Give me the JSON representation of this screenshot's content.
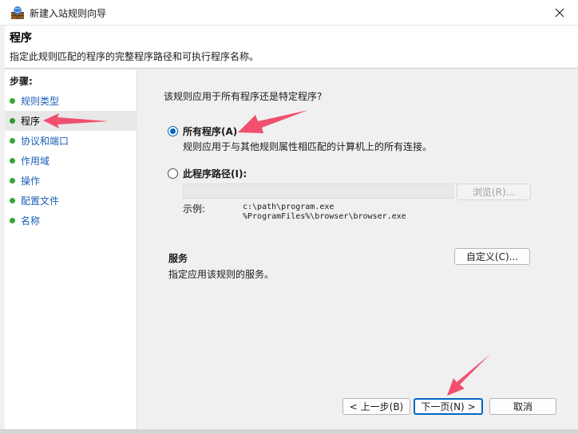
{
  "window": {
    "title": "新建入站规则向导"
  },
  "header": {
    "title": "程序",
    "description": "指定此规则匹配的程序的完整程序路径和可执行程序名称。"
  },
  "steps": {
    "heading": "步骤:",
    "items": [
      {
        "label": "规则类型"
      },
      {
        "label": "程序"
      },
      {
        "label": "协议和端口"
      },
      {
        "label": "作用域"
      },
      {
        "label": "操作"
      },
      {
        "label": "配置文件"
      },
      {
        "label": "名称"
      }
    ]
  },
  "content": {
    "question": "该规则应用于所有程序还是特定程序?",
    "all_programs": {
      "label": "所有程序(A)",
      "description": "规则应用于与其他规则属性相匹配的计算机上的所有连接。",
      "checked": true
    },
    "program_path": {
      "label": "此程序路径(I):",
      "value": "",
      "checked": false
    },
    "browse_button": "浏览(R)...",
    "example_label": "示例:",
    "example_line1": "c:\\path\\program.exe",
    "example_line2": "%ProgramFiles%\\browser\\browser.exe",
    "services_title": "服务",
    "services_description": "指定应用该规则的服务。",
    "customize_button": "自定义(C)..."
  },
  "footer": {
    "back_button": "< 上一步(B)",
    "next_button": "下一页(N) >",
    "cancel_button": "取消"
  },
  "colors": {
    "accent": "#0067c0",
    "annotation_arrow": "#f0506e",
    "step_dot": "#35a82f",
    "step_link": "#1a5fb4"
  }
}
